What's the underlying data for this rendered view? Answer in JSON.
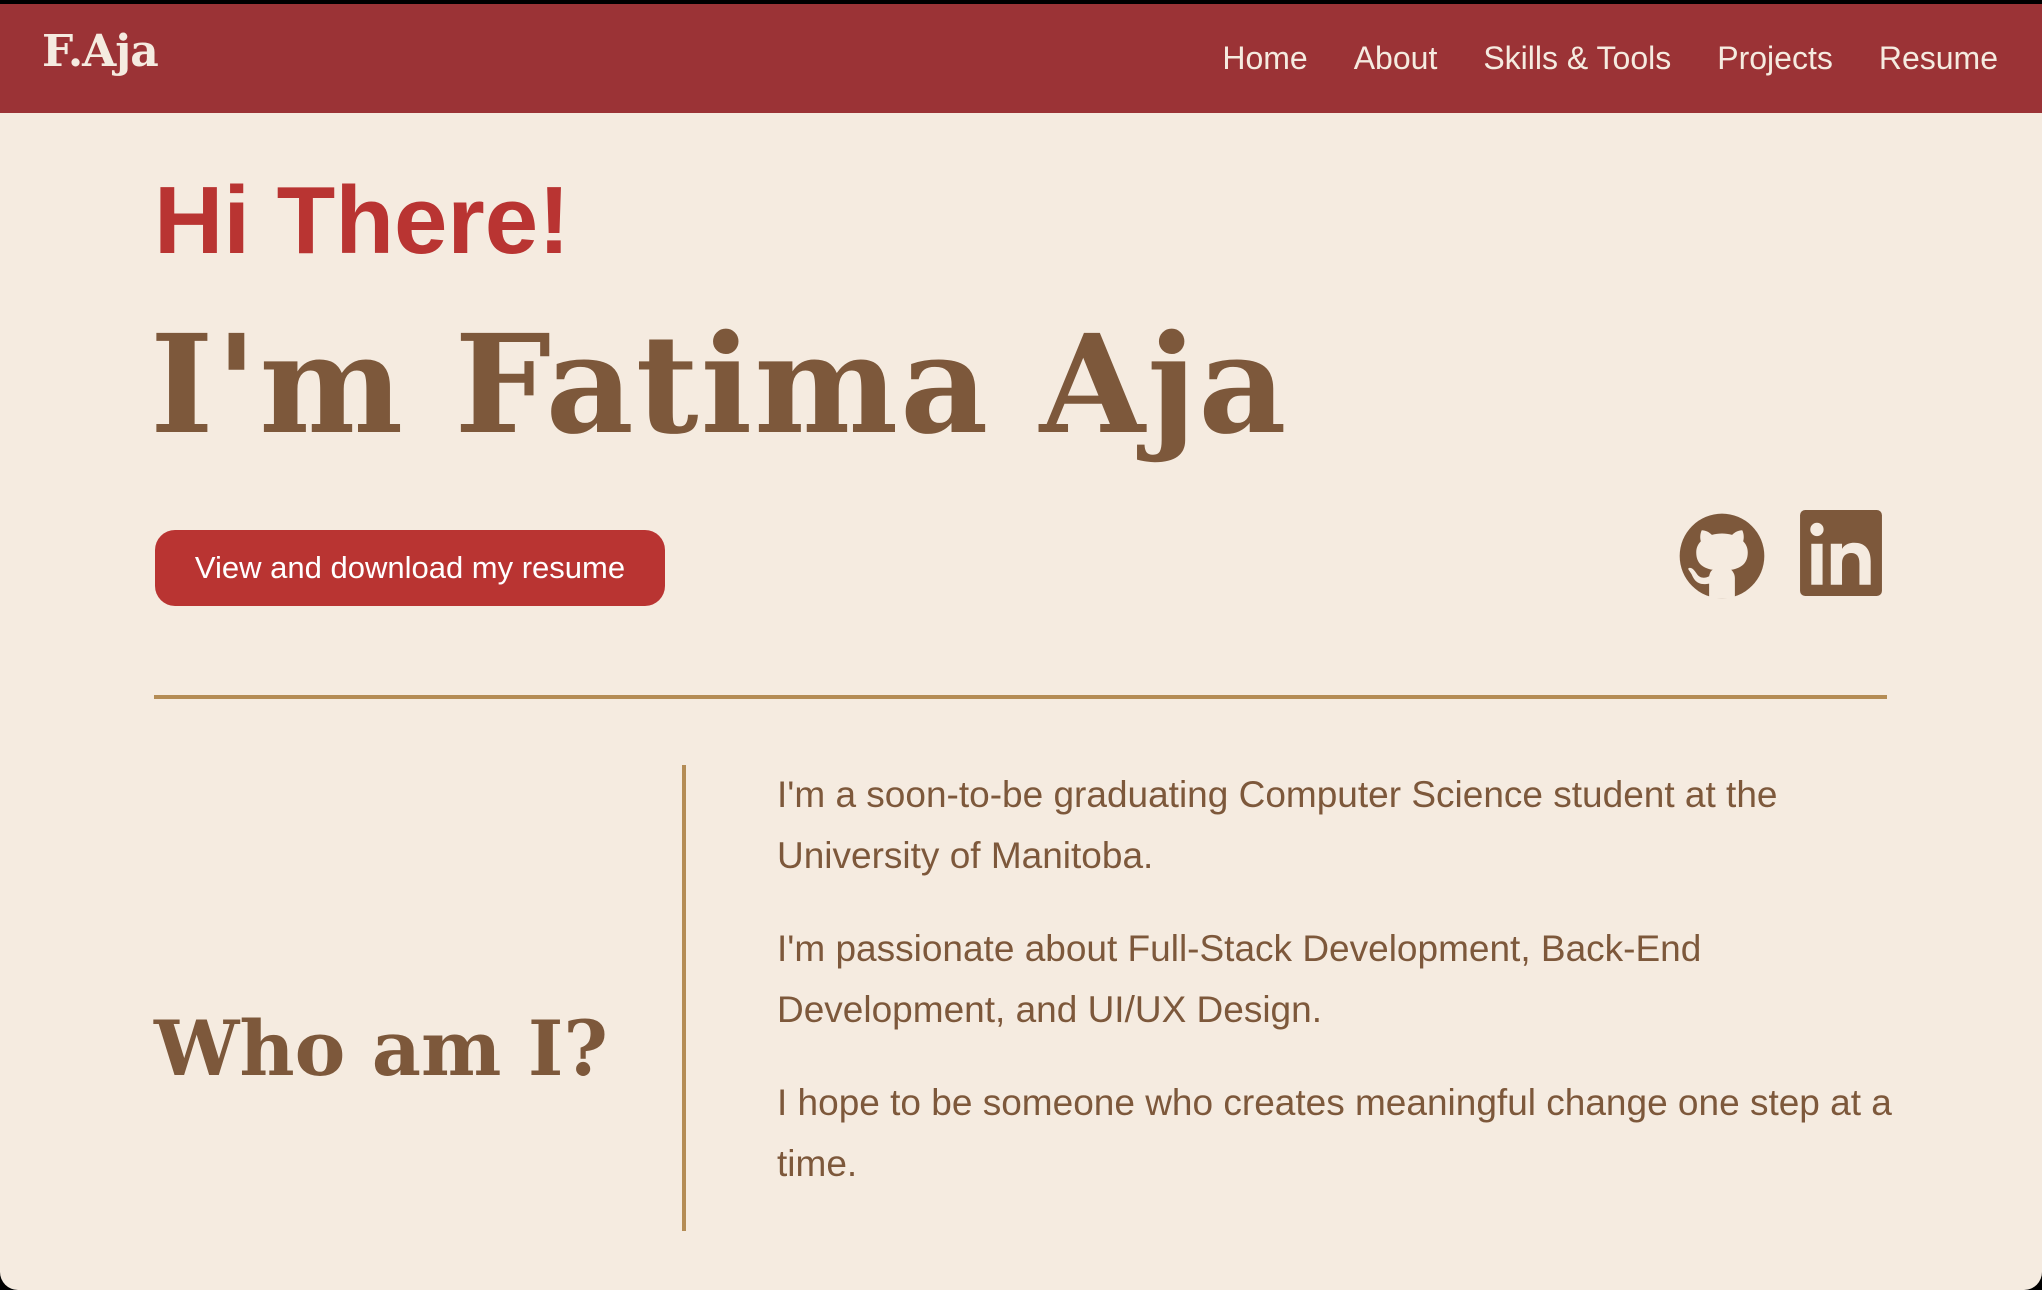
{
  "navbar": {
    "brand": "F.Aja",
    "links": [
      "Home",
      "About",
      "Skills & Tools",
      "Projects",
      "Resume"
    ]
  },
  "hero": {
    "greeting": "Hi There!",
    "name": "I'm Fatima Aja",
    "resume_button": "View and download my resume",
    "social": [
      "github-icon",
      "linkedin-icon"
    ]
  },
  "about": {
    "heading": "Who am I?",
    "paragraphs": [
      "I'm a soon-to-be graduating Computer Science student at the University of Manitoba.",
      "I'm passionate about Full-Stack Development, Back-End Development, and UI/UX Design.",
      "I hope to be someone who creates meaningful change one step at a time."
    ]
  },
  "colors": {
    "navbar_bg": "#9b3336",
    "page_bg": "#f5ebe0",
    "accent_red": "#b93432",
    "brown": "#7d583b",
    "gold": "#b48c55"
  }
}
